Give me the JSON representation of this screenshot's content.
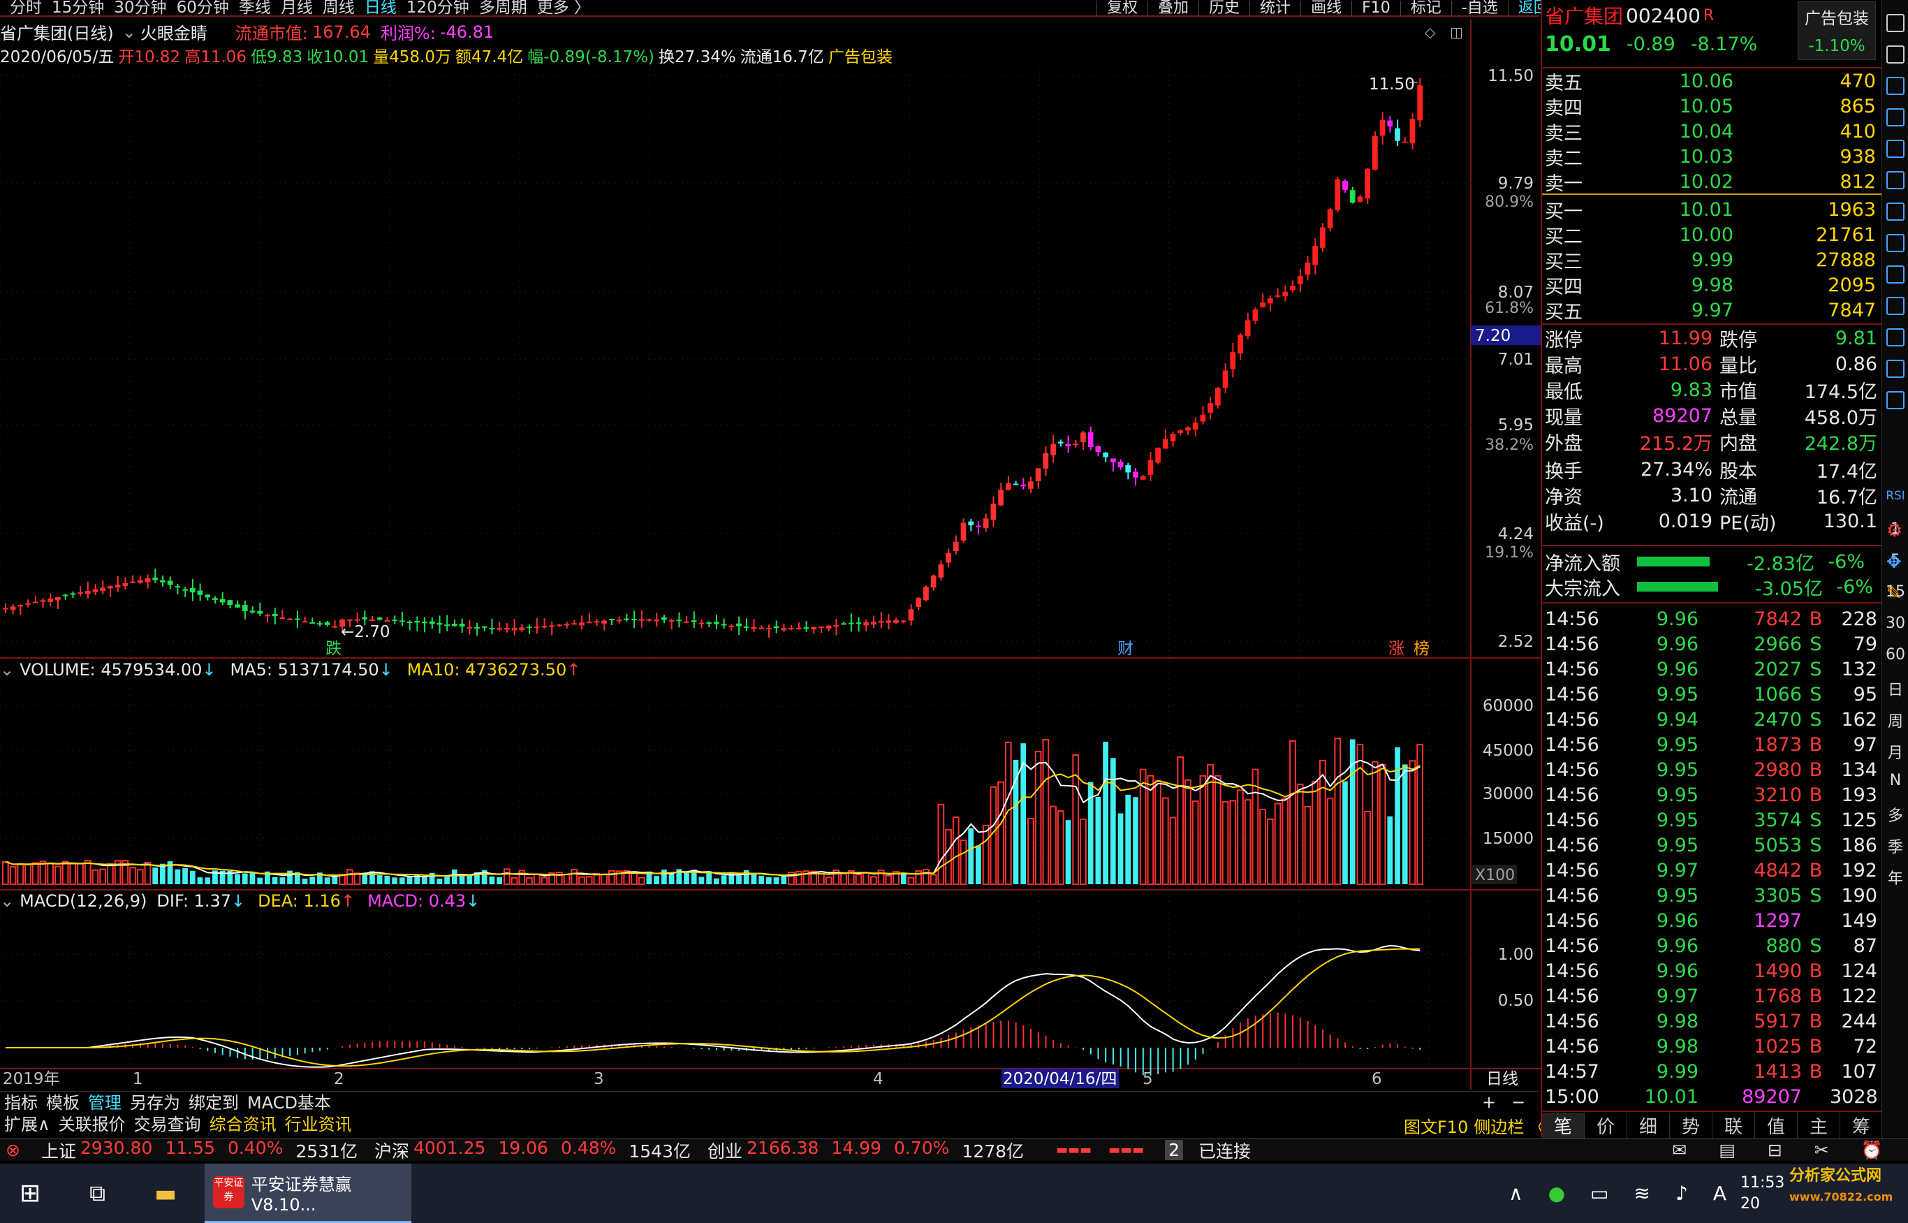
{
  "period_tabs": [
    "分时",
    "15分钟",
    "30分钟",
    "60分钟",
    "季线",
    "月线",
    "周线",
    "日线",
    "120分钟",
    "多周期",
    "更多 〉"
  ],
  "period_selected": "日线",
  "right_toolbar": [
    "复权",
    "叠加",
    "历史",
    "统计",
    "画线",
    "F10",
    "标记",
    "-自选",
    "返回"
  ],
  "chart_header": {
    "title": "省广集团(日线)",
    "indicator": "火眼金睛",
    "float_label": "流通市值:",
    "float_value": "167.64",
    "profit_label": "利润%:",
    "profit_value": "-46.81"
  },
  "bar_info": {
    "date": "2020/06/05/五",
    "open": "开10.82",
    "high": "高11.06",
    "low": "低9.83",
    "close": "收10.01",
    "vol": "量458.0万",
    "amt": "额47.4亿",
    "chg": "幅-0.89(-8.17%)",
    "turn": "换27.34%",
    "float": "流通16.7亿",
    "ad": "广告包装"
  },
  "price_axis": {
    "ticks": [
      "11.50",
      "9.79",
      "8.07",
      "7.01",
      "5.95",
      "4.24",
      "2.52"
    ],
    "pct": [
      "80.9%",
      "61.8%",
      "38.2%",
      "19.1%"
    ],
    "cursor": "7.20"
  },
  "chart_labels": {
    "high_mark": "11.50",
    "low_mark": "2.70",
    "tag_die": "跌",
    "tag_cai": "财",
    "tag_zhang": "涨",
    "tag_bang": "榜"
  },
  "volume_header": {
    "vol": "VOLUME: 4579534.00",
    "ma5": "MA5: 5137174.50",
    "ma10": "MA10: 4736273.50"
  },
  "volume_axis": {
    "ticks": [
      "60000",
      "45000",
      "30000",
      "15000"
    ],
    "unit": "X100"
  },
  "macd_header": {
    "title": "MACD(12,26,9)",
    "dif": "DIF: 1.37",
    "dea": "DEA: 1.16",
    "macd": "MACD: 0.43"
  },
  "macd_axis": {
    "ticks": [
      "1.00",
      "0.50"
    ]
  },
  "date_axis": {
    "labels": [
      "2019年",
      "1",
      "2",
      "3",
      "4",
      "5",
      "6"
    ],
    "cursor": "2020/04/16/四",
    "mode": "日线"
  },
  "bottom_tabs": [
    "指标",
    "模板",
    "管理",
    "另存为",
    "绑定到",
    "MACD基本"
  ],
  "bottom_tabs2": [
    "扩展∧",
    "关联报价",
    "交易查询",
    "综合资讯",
    "行业资讯"
  ],
  "stock": {
    "name": "省广集团",
    "code": "002400",
    "badge": "R",
    "price": "10.01",
    "change": "-0.89",
    "pct": "-8.17%",
    "ad": "广告包装",
    "ad_pct": "-1.10%"
  },
  "asks": [
    {
      "l": "卖五",
      "p": "10.06",
      "v": "470"
    },
    {
      "l": "卖四",
      "p": "10.05",
      "v": "865"
    },
    {
      "l": "卖三",
      "p": "10.04",
      "v": "410"
    },
    {
      "l": "卖二",
      "p": "10.03",
      "v": "938"
    },
    {
      "l": "卖一",
      "p": "10.02",
      "v": "812"
    }
  ],
  "bids": [
    {
      "l": "买一",
      "p": "10.01",
      "v": "1963"
    },
    {
      "l": "买二",
      "p": "10.00",
      "v": "21761"
    },
    {
      "l": "买三",
      "p": "9.99",
      "v": "27888"
    },
    {
      "l": "买四",
      "p": "9.98",
      "v": "2095"
    },
    {
      "l": "买五",
      "p": "9.97",
      "v": "7847"
    }
  ],
  "fund": [
    {
      "a": "涨停",
      "b": "11.99",
      "bc": "red",
      "c": "跌停",
      "d": "9.81",
      "dc": "grn"
    },
    {
      "a": "最高",
      "b": "11.06",
      "bc": "red",
      "c": "量比",
      "d": "0.86",
      "dc": "wht"
    },
    {
      "a": "最低",
      "b": "9.83",
      "bc": "grn",
      "c": "市值",
      "d": "174.5亿",
      "dc": "wht"
    },
    {
      "a": "现量",
      "b": "89207",
      "bc": "mag",
      "c": "总量",
      "d": "458.0万",
      "dc": "wht"
    },
    {
      "a": "外盘",
      "b": "215.2万",
      "bc": "red",
      "c": "内盘",
      "d": "242.8万",
      "dc": "grn"
    },
    {
      "a": "换手",
      "b": "27.34%",
      "bc": "wht",
      "c": "股本",
      "d": "17.4亿",
      "dc": "wht"
    },
    {
      "a": "净资",
      "b": "3.10",
      "bc": "wht",
      "c": "流通",
      "d": "16.7亿",
      "dc": "wht"
    },
    {
      "a": "收益(-)",
      "b": "0.019",
      "bc": "wht",
      "c": "PE(动)",
      "d": "130.1",
      "dc": "wht"
    }
  ],
  "flows": [
    {
      "l": "净流入额",
      "v": "-2.83亿",
      "p": "-6%"
    },
    {
      "l": "大宗流入",
      "v": "-3.05亿",
      "p": "-6%"
    }
  ],
  "trades": [
    [
      "14:56",
      "9.96",
      "7842",
      "B",
      "228"
    ],
    [
      "14:56",
      "9.96",
      "2966",
      "S",
      "79"
    ],
    [
      "14:56",
      "9.96",
      "2027",
      "S",
      "132"
    ],
    [
      "14:56",
      "9.95",
      "1066",
      "S",
      "95"
    ],
    [
      "14:56",
      "9.94",
      "2470",
      "S",
      "162"
    ],
    [
      "14:56",
      "9.95",
      "1873",
      "B",
      "97"
    ],
    [
      "14:56",
      "9.95",
      "2980",
      "B",
      "134"
    ],
    [
      "14:56",
      "9.95",
      "3210",
      "B",
      "193"
    ],
    [
      "14:56",
      "9.95",
      "3574",
      "S",
      "125"
    ],
    [
      "14:56",
      "9.95",
      "5053",
      "S",
      "186"
    ],
    [
      "14:56",
      "9.97",
      "4842",
      "B",
      "192"
    ],
    [
      "14:56",
      "9.95",
      "3305",
      "S",
      "190"
    ],
    [
      "14:56",
      "9.96",
      "1297",
      "",
      "149"
    ],
    [
      "14:56",
      "9.96",
      "880",
      "S",
      "87"
    ],
    [
      "14:56",
      "9.96",
      "1490",
      "B",
      "124"
    ],
    [
      "14:56",
      "9.97",
      "1768",
      "B",
      "122"
    ],
    [
      "14:56",
      "9.98",
      "5917",
      "B",
      "244"
    ],
    [
      "14:56",
      "9.98",
      "1025",
      "B",
      "72"
    ],
    [
      "14:57",
      "9.99",
      "1413",
      "B",
      "107"
    ],
    [
      "15:00",
      "10.01",
      "89207",
      "",
      "3028"
    ]
  ],
  "panel_tabs": [
    "笔",
    "价",
    "细",
    "势",
    "联",
    "值",
    "主",
    "筹"
  ],
  "side_tabs": [
    "RSI",
    "1",
    "5",
    "15",
    "30",
    "60",
    "日",
    "周",
    "月",
    "N",
    "多",
    "季",
    "年"
  ],
  "bottom_right": {
    "f10": "图文F10",
    "side": "侧边栏 《"
  },
  "index_bar": [
    {
      "n": "上证",
      "v": "2930.80",
      "c": "11.55",
      "p": "0.40%",
      "a": "2531亿"
    },
    {
      "n": "沪深",
      "v": "4001.25",
      "c": "19.06",
      "p": "0.48%",
      "a": "1543亿"
    },
    {
      "n": "创业",
      "v": "2166.38",
      "c": "14.99",
      "p": "0.70%",
      "a": "1278亿"
    }
  ],
  "conn": {
    "num": "2",
    "text": "已连接"
  },
  "taskbar": {
    "app": "平安证券慧赢V8.10...",
    "app_logo": "平安证券",
    "time": "11:53",
    "date": "20",
    "watermark": "分析家公式网",
    "watermark_url": "www.70822.com"
  },
  "colors": {
    "up": "#ff2020",
    "down": "#40f0f0",
    "green": "#2bd94a",
    "ma5": "#ffffff",
    "ma10": "#ffd600"
  }
}
